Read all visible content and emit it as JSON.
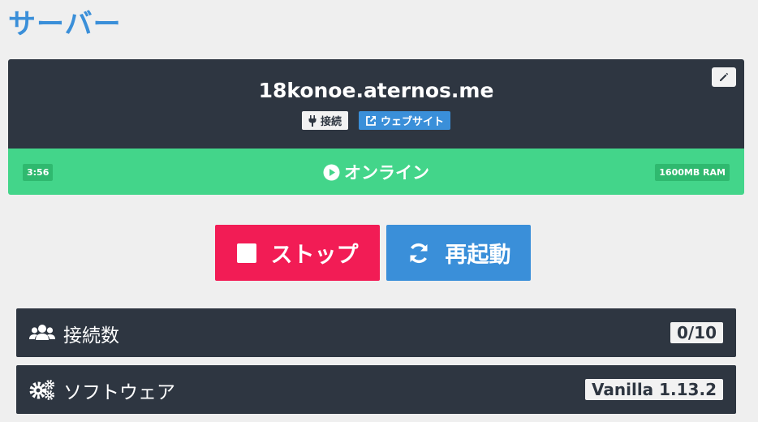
{
  "page": {
    "title": "サーバー"
  },
  "server": {
    "address": "18konoe.aternos.me",
    "connect_label": "接続",
    "website_label": "ウェブサイト",
    "status": {
      "uptime": "3:56",
      "state": "オンライン",
      "ram": "1600MB RAM",
      "color": "#43d58a"
    }
  },
  "actions": {
    "stop_label": "ストップ",
    "restart_label": "再起動",
    "stop_color": "#f21c55",
    "restart_color": "#3a8fd9"
  },
  "info": {
    "players_label": "接続数",
    "players_value": "0/10",
    "software_label": "ソフトウェア",
    "software_value": "Vanilla 1.13.2"
  },
  "icons": [
    "pencil-icon",
    "plug-icon",
    "external-link-icon",
    "play-circle-icon",
    "stop-icon",
    "refresh-icon",
    "users-icon",
    "gears-icon"
  ]
}
